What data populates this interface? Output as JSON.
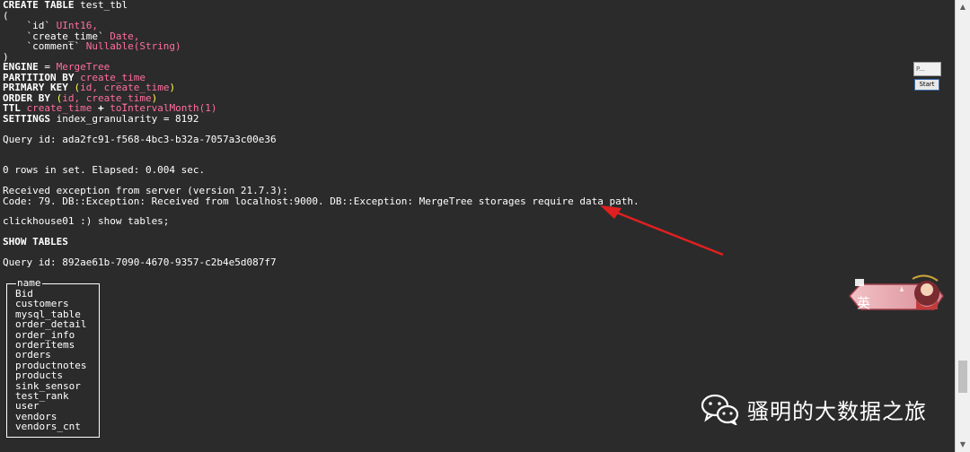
{
  "terminal": {
    "create_kw": "CREATE TABLE",
    "table_name": " test_tbl",
    "open_paren": "(",
    "col1_name": "    `id`",
    "col1_type": " UInt16,",
    "col2_name": "    `create_time`",
    "col2_type": " Date,",
    "col3_name": "    `comment`",
    "col3_type": " Nullable(String)",
    "close_paren": ")",
    "engine_kw": "ENGINE",
    "engine_eq": " = ",
    "engine_val": "MergeTree",
    "partition_kw": "PARTITION BY",
    "partition_val": " create_time",
    "primary_kw": "PRIMARY KEY",
    "primary_open": " (",
    "primary_val": "id, create_time",
    "primary_close": ")",
    "order_kw": "ORDER BY",
    "order_open": " (",
    "order_val": "id, create_time",
    "order_close": ")",
    "ttl_kw": "TTL",
    "ttl_val1": " create_time",
    "ttl_plus": " + ",
    "ttl_val2": "toIntervalMonth(1)",
    "settings_kw": "SETTINGS",
    "settings_val": " index_granularity = 8192",
    "query_id_1": "Query id: ada2fc91-f568-4bc3-b32a-7057a3c00e36",
    "rows_line": "0 rows in set. Elapsed: 0.004 sec.",
    "exception_line": "Received exception from server (version 21.7.3):",
    "code_line": "Code: 79. DB::Exception: Received from localhost:9000. DB::Exception: MergeTree storages require data path.",
    "prompt_line": "clickhouse01 :) show tables;",
    "show_tables": "SHOW TABLES",
    "query_id_2": "Query id: 892ae61b-7090-4670-9357-c2b4e5d087f7"
  },
  "result": {
    "header": "name",
    "rows": [
      "Bid",
      "customers",
      "mysql_table",
      "order_detail",
      "order_info",
      "orderitems",
      "orders",
      "productnotes",
      "products",
      "sink_sensor",
      "test_rank",
      "user",
      "vendors",
      "vendors_cnt"
    ]
  },
  "widget": {
    "top_label": "P...",
    "start_label": "Start"
  },
  "ime": {
    "label": "英"
  },
  "watermark": {
    "text": "骚明的大数据之旅"
  },
  "scrollbar": {
    "up": "▲",
    "down": "▼"
  },
  "colors": {
    "background": "#2b2b2b",
    "keyword": "#ffffff",
    "string": "#ffff55",
    "identifier": "#ff6e9e",
    "arrow": "#e02020"
  }
}
